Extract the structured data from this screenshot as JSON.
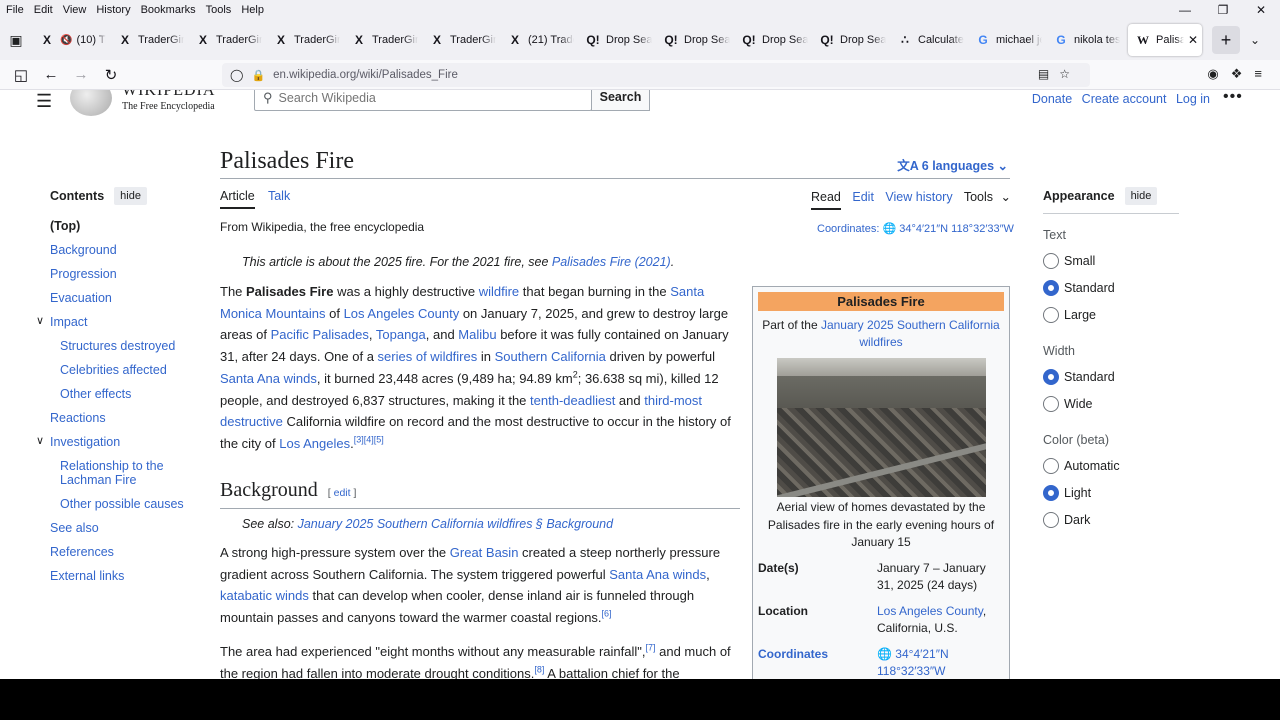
{
  "browser": {
    "menu": [
      "File",
      "Edit",
      "View",
      "History",
      "Bookmarks",
      "Tools",
      "Help"
    ],
    "tabs": [
      {
        "icon": "x-logo-icon",
        "glyph": "X",
        "label": "(10) Tr"
      },
      {
        "icon": "x-logo-icon",
        "glyph": "X",
        "label": "TraderGirl"
      },
      {
        "icon": "x-logo-icon",
        "glyph": "X",
        "label": "TraderGirl"
      },
      {
        "icon": "x-logo-icon",
        "glyph": "X",
        "label": "TraderGirl"
      },
      {
        "icon": "x-logo-icon",
        "glyph": "X",
        "label": "TraderGirl"
      },
      {
        "icon": "x-logo-icon",
        "glyph": "X",
        "label": "TraderGirl"
      },
      {
        "icon": "x-logo-icon",
        "glyph": "X",
        "label": "(21) Trade"
      },
      {
        "icon": "dropsearch-icon",
        "glyph": "Q!",
        "label": "Drop Sea"
      },
      {
        "icon": "dropsearch-icon",
        "glyph": "Q!",
        "label": "Drop Sea"
      },
      {
        "icon": "dropsearch-icon",
        "glyph": "Q!",
        "label": "Drop Sea"
      },
      {
        "icon": "dropsearch-icon",
        "glyph": "Q!",
        "label": "Drop Sea"
      },
      {
        "icon": "calculator-icon",
        "glyph": "∴",
        "label": "Calculate"
      },
      {
        "icon": "google-icon",
        "glyph": "G",
        "label": "michael je"
      },
      {
        "icon": "google-icon",
        "glyph": "G",
        "label": "nikola tes"
      }
    ],
    "active_tab": {
      "glyph": "W",
      "label": "Palisade"
    },
    "url": "en.wikipedia.org/wiki/Palisades_Fire"
  },
  "wiki": {
    "logo_word": "Wikipedia",
    "logo_tagline": "The Free Encyclopedia",
    "search_placeholder": "Search Wikipedia",
    "search_button": "Search",
    "top_links": [
      "Donate",
      "Create account",
      "Log in"
    ],
    "toc": {
      "title": "Contents",
      "hide": "hide",
      "items": [
        {
          "label": "(Top)",
          "level": "top"
        },
        {
          "label": "Background",
          "level": "1"
        },
        {
          "label": "Progression",
          "level": "1"
        },
        {
          "label": "Evacuation",
          "level": "1"
        },
        {
          "label": "Impact",
          "level": "1",
          "toggle": true
        },
        {
          "label": "Structures destroyed",
          "level": "2"
        },
        {
          "label": "Celebrities affected",
          "level": "2"
        },
        {
          "label": "Other effects",
          "level": "2"
        },
        {
          "label": "Reactions",
          "level": "1"
        },
        {
          "label": "Investigation",
          "level": "1",
          "toggle": true
        },
        {
          "label": "Relationship to the Lachman Fire",
          "level": "2",
          "tall": true
        },
        {
          "label": "Other possible causes",
          "level": "2"
        },
        {
          "label": "See also",
          "level": "1"
        },
        {
          "label": "References",
          "level": "1"
        },
        {
          "label": "External links",
          "level": "1"
        }
      ]
    },
    "article": {
      "title": "Palisades Fire",
      "languages": "6 languages",
      "tab_article": "Article",
      "tab_talk": "Talk",
      "tab_read": "Read",
      "tab_edit": "Edit",
      "tab_history": "View history",
      "tab_tools": "Tools",
      "from": "From Wikipedia, the free encyclopedia",
      "coordinates_label": "Coordinates:",
      "coordinates": "34°4′21″N 118°32′33″W",
      "hatnote_prefix": "This article is about the 2025 fire. For the 2021 fire, see ",
      "hatnote_link": "Palisades Fire (2021)",
      "background_heading": "Background",
      "edit_link": "edit",
      "see_also_prefix": "See also: ",
      "see_also_link": "January 2025 Southern California wildfires § Background"
    },
    "infobox": {
      "title": "Palisades Fire",
      "part_of_prefix": "Part of the ",
      "part_of_link": "January 2025 Southern California wildfires",
      "caption": "Aerial view of homes devastated by the Palisades fire in the early evening hours of January 15",
      "rows": [
        {
          "key": "Date(s)",
          "value": "January 7 – January 31, 2025 (24 days)"
        },
        {
          "key": "Location",
          "value_link": "Los Angeles County",
          "value": ", California, U.S."
        },
        {
          "key": "Coordinates",
          "value": "34°4′21″N 118°32′33″W"
        }
      ]
    },
    "appearance": {
      "title": "Appearance",
      "hide": "hide",
      "text_label": "Text",
      "text_options": [
        {
          "label": "Small",
          "on": false
        },
        {
          "label": "Standard",
          "on": true
        },
        {
          "label": "Large",
          "on": false
        }
      ],
      "width_label": "Width",
      "width_options": [
        {
          "label": "Standard",
          "on": true
        },
        {
          "label": "Wide",
          "on": false
        }
      ],
      "color_label": "Color (beta)",
      "color_options": [
        {
          "label": "Automatic",
          "on": false
        },
        {
          "label": "Light",
          "on": true
        },
        {
          "label": "Dark",
          "on": false
        }
      ]
    }
  },
  "colors": {
    "link": "#3366cc",
    "infobox_header": "#f4a460"
  }
}
